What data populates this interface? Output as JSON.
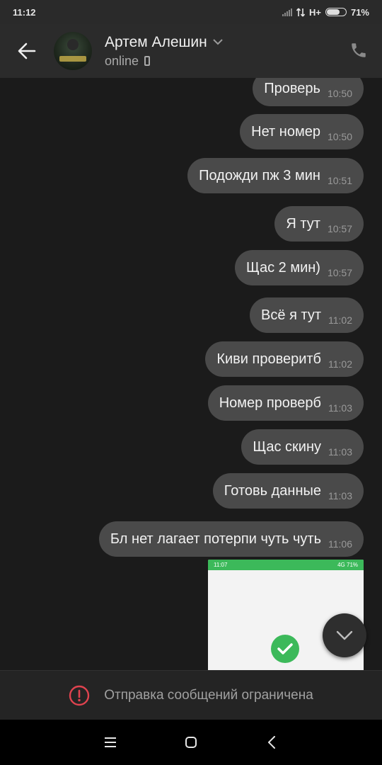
{
  "status": {
    "time": "11:12",
    "network": "H+",
    "battery": "71%",
    "battery_level": 0.71
  },
  "header": {
    "name": "Артем Алешин",
    "status": "online"
  },
  "messages": [
    {
      "text": "Проверь",
      "time": "10:50"
    },
    {
      "text": "Нет номер",
      "time": "10:50"
    },
    {
      "text": "Подожди пж 3 мин",
      "time": "10:51"
    },
    {
      "text": "Я тут",
      "time": "10:57"
    },
    {
      "text": "Щас 2 мин)",
      "time": "10:57"
    },
    {
      "text": "Всё я тут",
      "time": "11:02"
    },
    {
      "text": "Киви проверитб",
      "time": "11:02"
    },
    {
      "text": "Номер проверб",
      "time": "11:03"
    },
    {
      "text": "Щас скину",
      "time": "11:03"
    },
    {
      "text": "Готовь данные",
      "time": "11:03"
    },
    {
      "text": "Бл нет лагает потерпи чуть чуть",
      "time": "11:06"
    }
  ],
  "image_message": {
    "mini_time": "11:07",
    "mini_status": "4G 71%"
  },
  "restriction": {
    "text": "Отправка сообщений ограничена"
  },
  "icons": {
    "back": "arrow-left-icon",
    "call": "phone-icon",
    "caret": "chevron-down-icon",
    "scroll": "chevron-down-icon",
    "warning": "exclamation-circle-icon",
    "nav_menu": "menu-icon",
    "nav_home": "square-icon",
    "nav_back": "chevron-left-icon"
  },
  "colors": {
    "bubble": "#4a4a4a",
    "background": "#1b1b1b",
    "accent_green": "#3cb95a",
    "warning_red": "#e0434f"
  }
}
